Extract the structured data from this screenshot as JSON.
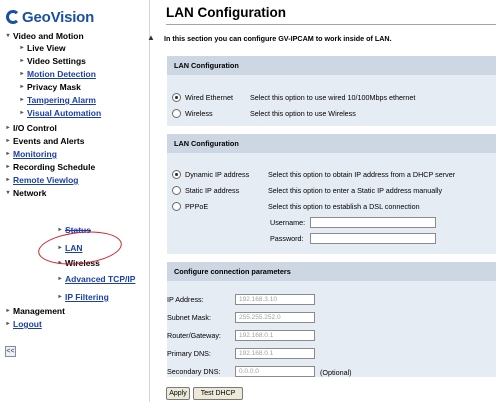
{
  "nav": {
    "logo_text": "GeoVision",
    "collapse_label": "<<",
    "items": [
      {
        "label": "Video and Motion"
      },
      {
        "label": "Live View"
      },
      {
        "label": "Video Settings"
      },
      {
        "label": "Motion Detection"
      },
      {
        "label": "Privacy Mask"
      },
      {
        "label": "Tampering Alarm"
      },
      {
        "label": "Visual Automation"
      },
      {
        "label": "I/O Control"
      },
      {
        "label": "Events and Alerts"
      },
      {
        "label": "Monitoring"
      },
      {
        "label": "Recording Schedule"
      },
      {
        "label": "Remote Viewlog"
      },
      {
        "label": "Network"
      },
      {
        "label": "Status"
      },
      {
        "label": "LAN"
      },
      {
        "label": "Wireless"
      },
      {
        "label": "Advanced TCP/IP"
      },
      {
        "label": "IP Filtering"
      },
      {
        "label": "Management"
      },
      {
        "label": "Logout"
      }
    ]
  },
  "main": {
    "title": "LAN Configuration",
    "intro": "In this section you can configure GV-IPCAM to work inside of LAN.",
    "section1": {
      "header": "LAN Configuration",
      "options": [
        {
          "label": "Wired Ethernet",
          "desc": "Select this option to use wired 10/100Mbps ethernet",
          "selected": true
        },
        {
          "label": "Wireless",
          "desc": "Select this option to use Wireless",
          "selected": false
        }
      ]
    },
    "section2": {
      "header": "LAN Configuration",
      "options": [
        {
          "label": "Dynamic IP address",
          "desc": "Select this option to obtain IP address from a DHCP server",
          "selected": true
        },
        {
          "label": "Static IP address",
          "desc": "Select this option to enter a Static IP address manually",
          "selected": false
        },
        {
          "label": "PPPoE",
          "desc": "Select this option to establish a DSL connection",
          "selected": false
        }
      ],
      "username_label": "Username:",
      "username_value": "",
      "password_label": "Password:",
      "password_value": ""
    },
    "section3": {
      "header": "Configure connection parameters",
      "fields": [
        {
          "label": "IP Address:",
          "value": "192.168.3.10"
        },
        {
          "label": "Subnet Mask:",
          "value": "255.255.252.0"
        },
        {
          "label": "Router/Gateway:",
          "value": "192.168.0.1"
        },
        {
          "label": "Primary DNS:",
          "value": "192.168.0.1"
        },
        {
          "label": "Secondary DNS:",
          "value": "0.0.0.0"
        }
      ],
      "optional_note": "(Optional)"
    },
    "buttons": {
      "apply": "Apply",
      "test_dhcp": "Test DHCP"
    }
  }
}
